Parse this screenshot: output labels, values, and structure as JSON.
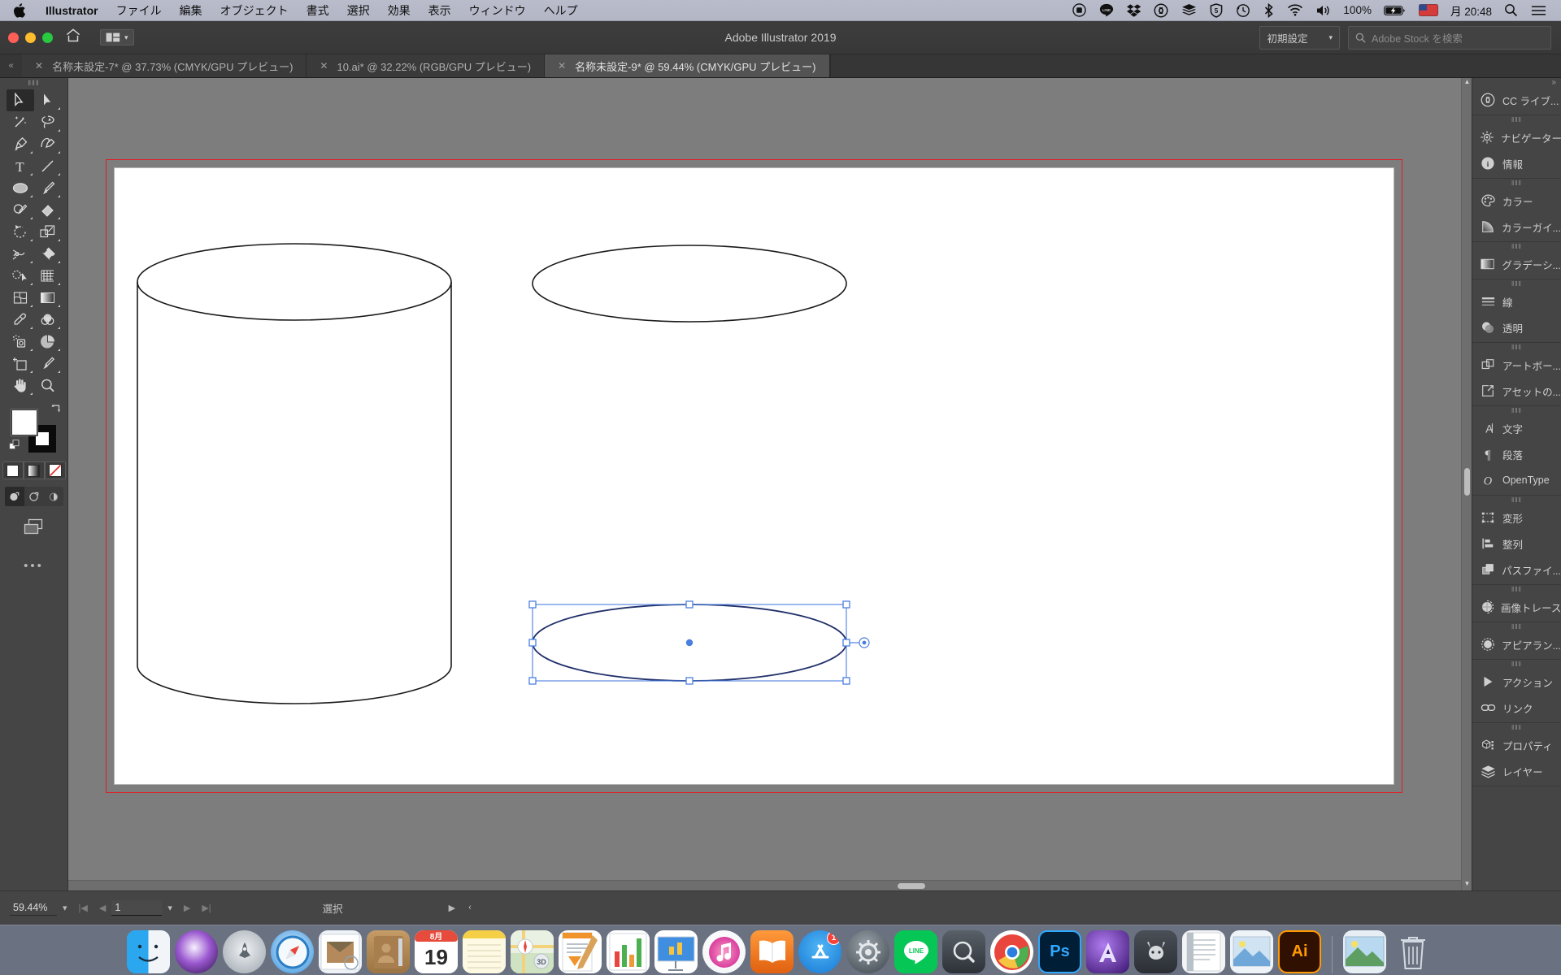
{
  "macbar": {
    "apple": "apple-logo",
    "app": "Illustrator",
    "menus": [
      "ファイル",
      "編集",
      "オブジェクト",
      "書式",
      "選択",
      "効果",
      "表示",
      "ウィンドウ",
      "ヘルプ"
    ],
    "status_icons": [
      "record-icon",
      "line-icon",
      "dropbox-icon",
      "creative-cloud-icon",
      "stack-icon",
      "shield5-icon",
      "time-machine-icon",
      "bluetooth-icon",
      "wifi-icon",
      "volume-icon"
    ],
    "battery_percent": "100%",
    "input_source": "A",
    "clock": "月 20:48",
    "search_icon": "search-icon",
    "menu_icon": "control-center-icon"
  },
  "titlebar": {
    "app_title": "Adobe Illustrator 2019",
    "arrange_icon": "arrange-documents-icon",
    "home_icon": "home-icon",
    "workspace": "初期設定",
    "stock_placeholder": "Adobe Stock を検索",
    "stock_icon": "adobe-stock-icon"
  },
  "tabs": [
    {
      "label": "名称未設定-7* @ 37.73% (CMYK/GPU プレビュー)",
      "active": false
    },
    {
      "label": "10.ai* @ 32.22% (RGB/GPU プレビュー)",
      "active": false
    },
    {
      "label": "名称未設定-9* @ 59.44% (CMYK/GPU プレビュー)",
      "active": true
    }
  ],
  "toolbar": {
    "tools": [
      {
        "name": "selection-tool",
        "glyph": "selection",
        "selected": true
      },
      {
        "name": "direct-selection-tool",
        "glyph": "direct",
        "selected": false
      },
      {
        "name": "magic-wand-tool",
        "glyph": "wand",
        "selected": false
      },
      {
        "name": "lasso-tool",
        "glyph": "lasso",
        "selected": false
      },
      {
        "name": "pen-tool",
        "glyph": "pen",
        "selected": false
      },
      {
        "name": "curvature-tool",
        "glyph": "curvature",
        "selected": false
      },
      {
        "name": "type-tool",
        "glyph": "type",
        "selected": false
      },
      {
        "name": "line-segment-tool",
        "glyph": "line",
        "selected": false
      },
      {
        "name": "ellipse-tool",
        "glyph": "ellipse",
        "selected": false
      },
      {
        "name": "paintbrush-tool",
        "glyph": "brush",
        "selected": false
      },
      {
        "name": "shaper-tool",
        "glyph": "shaper",
        "selected": false
      },
      {
        "name": "eraser-tool",
        "glyph": "eraser",
        "selected": false
      },
      {
        "name": "rotate-tool",
        "glyph": "rotate",
        "selected": false
      },
      {
        "name": "scale-tool",
        "glyph": "scale",
        "selected": false
      },
      {
        "name": "width-tool",
        "glyph": "width",
        "selected": false
      },
      {
        "name": "free-transform-tool",
        "glyph": "pin",
        "selected": false
      },
      {
        "name": "shape-builder-tool",
        "glyph": "shapebuilder",
        "selected": false
      },
      {
        "name": "perspective-grid-tool",
        "glyph": "perspective",
        "selected": false
      },
      {
        "name": "mesh-tool",
        "glyph": "mesh",
        "selected": false
      },
      {
        "name": "gradient-tool",
        "glyph": "gradient",
        "selected": false
      },
      {
        "name": "eyedropper-tool",
        "glyph": "eyedropper",
        "selected": false
      },
      {
        "name": "blend-tool",
        "glyph": "blend",
        "selected": false
      },
      {
        "name": "symbol-sprayer-tool",
        "glyph": "sprayer",
        "selected": false
      },
      {
        "name": "column-graph-tool",
        "glyph": "graph",
        "selected": false
      },
      {
        "name": "artboard-tool",
        "glyph": "artboard",
        "selected": false
      },
      {
        "name": "slice-tool",
        "glyph": "slice",
        "selected": false
      },
      {
        "name": "hand-tool",
        "glyph": "hand",
        "selected": false
      },
      {
        "name": "zoom-tool",
        "glyph": "zoom",
        "selected": false
      }
    ],
    "fill_color": "#ffffff",
    "stroke_color": "#000000",
    "paint_modes": [
      "color-swatch",
      "gradient-swatch",
      "none-swatch"
    ],
    "draw_modes": [
      "draw-normal",
      "draw-behind",
      "draw-inside"
    ],
    "screen_mode_icon": "change-screen-mode-icon",
    "more_tools": "•••"
  },
  "canvas": {
    "zoom": "59.44%",
    "artboard_bg": "#ffffff",
    "bleed_color": "#e11d26",
    "shapes": [
      {
        "name": "cylinder-body",
        "type": "cylinder"
      },
      {
        "name": "ellipse-top-right",
        "type": "ellipse"
      },
      {
        "name": "ellipse-selected",
        "type": "ellipse",
        "selected": true
      }
    ],
    "selection_color": "#4a7fe0"
  },
  "right_dock": {
    "collapse_icon": "double-arrow-right-icon",
    "groups": [
      {
        "items": [
          {
            "label": "CC ライブ...",
            "icon": "creative-cloud-libraries-icon"
          }
        ]
      },
      {
        "items": [
          {
            "label": "ナビゲーター",
            "icon": "navigator-icon"
          },
          {
            "label": "情報",
            "icon": "info-icon"
          }
        ]
      },
      {
        "items": [
          {
            "label": "カラー",
            "icon": "color-icon"
          },
          {
            "label": "カラーガイ...",
            "icon": "color-guide-icon"
          }
        ]
      },
      {
        "items": [
          {
            "label": "グラデーシ...",
            "icon": "gradient-icon"
          }
        ]
      },
      {
        "items": [
          {
            "label": "線",
            "icon": "stroke-icon"
          },
          {
            "label": "透明",
            "icon": "transparency-icon"
          }
        ]
      },
      {
        "items": [
          {
            "label": "アートボー...",
            "icon": "artboards-icon"
          },
          {
            "label": "アセットの...",
            "icon": "asset-export-icon"
          }
        ]
      },
      {
        "items": [
          {
            "label": "文字",
            "icon": "character-icon"
          },
          {
            "label": "段落",
            "icon": "paragraph-icon"
          },
          {
            "label": "OpenType",
            "icon": "opentype-icon"
          }
        ]
      },
      {
        "items": [
          {
            "label": "変形",
            "icon": "transform-icon"
          },
          {
            "label": "整列",
            "icon": "align-icon"
          },
          {
            "label": "パスファイ...",
            "icon": "pathfinder-icon"
          }
        ]
      },
      {
        "items": [
          {
            "label": "画像トレース",
            "icon": "image-trace-icon"
          }
        ]
      },
      {
        "items": [
          {
            "label": "アピアラン...",
            "icon": "appearance-icon"
          }
        ]
      },
      {
        "items": [
          {
            "label": "アクション",
            "icon": "actions-icon"
          },
          {
            "label": "リンク",
            "icon": "links-icon"
          }
        ]
      },
      {
        "items": [
          {
            "label": "プロパティ",
            "icon": "properties-icon"
          },
          {
            "label": "レイヤー",
            "icon": "layers-icon"
          }
        ]
      }
    ]
  },
  "statusbar": {
    "zoom_value": "59.44%",
    "zoom_dropdown_icon": "chevron-down-icon",
    "first_page_icon": "first-page-icon",
    "prev_page_icon": "prev-page-icon",
    "page_value": "1",
    "page_dropdown_icon": "chevron-down-icon",
    "next_page_icon": "next-page-icon",
    "last_page_icon": "last-page-icon",
    "status_text": "選択",
    "status_menu_icon": "play-right-icon",
    "resize_icon": "chevron-left-icon"
  },
  "dock": {
    "items": [
      {
        "name": "finder",
        "label": "",
        "color": "#2aa7ef",
        "running": true
      },
      {
        "name": "siri",
        "label": "",
        "color": "#5a3e8e",
        "running": false
      },
      {
        "name": "launchpad",
        "label": "",
        "color": "#9aa0a6",
        "running": false
      },
      {
        "name": "safari",
        "label": "",
        "color": "#2b8fe0",
        "running": false
      },
      {
        "name": "mail",
        "label": "",
        "color": "#dfe6ee",
        "running": false
      },
      {
        "name": "contacts",
        "label": "",
        "color": "#a07848",
        "running": false
      },
      {
        "name": "calendar",
        "label": "19",
        "color": "#ffffff",
        "running": false
      },
      {
        "name": "notes",
        "label": "",
        "color": "#fdf3c0",
        "running": true
      },
      {
        "name": "maps",
        "label": "",
        "color": "#d8ecd0",
        "running": false
      },
      {
        "name": "pages",
        "label": "",
        "color": "#f3a23a",
        "running": false
      },
      {
        "name": "numbers",
        "label": "",
        "color": "#4caf50",
        "running": true
      },
      {
        "name": "keynote",
        "label": "",
        "color": "#3f8ee0",
        "running": false
      },
      {
        "name": "itunes",
        "label": "",
        "color": "#f06292",
        "running": false
      },
      {
        "name": "ibooks",
        "label": "",
        "color": "#e0681f",
        "running": false
      },
      {
        "name": "app-store",
        "label": "",
        "color": "#2b8fe0",
        "running": true,
        "badge": "1"
      },
      {
        "name": "system-preferences",
        "label": "",
        "color": "#6b7280",
        "running": false
      },
      {
        "name": "line",
        "label": "LINE",
        "color": "#06c755",
        "running": true
      },
      {
        "name": "quicklook",
        "label": "Q",
        "color": "#3a3f46",
        "running": false
      },
      {
        "name": "chrome",
        "label": "",
        "color": "#f4f4f4",
        "running": true
      },
      {
        "name": "photoshop",
        "label": "Ps",
        "color": "#001e36",
        "running": true
      },
      {
        "name": "after-effects",
        "label": "",
        "color": "#1f0a3c",
        "running": true
      },
      {
        "name": "deer-app",
        "label": "",
        "color": "#3c3f46",
        "running": false
      },
      {
        "name": "text-editor",
        "label": "",
        "color": "#f2f2f2",
        "running": false
      },
      {
        "name": "preview",
        "label": "",
        "color": "#dfe7f0",
        "running": false
      },
      {
        "name": "illustrator",
        "label": "Ai",
        "color": "#301000",
        "running": true
      },
      {
        "name": "pictures-folder",
        "label": "",
        "color": "#6fa8d8",
        "running": false
      },
      {
        "name": "trash",
        "label": "",
        "color": "#c9ced6",
        "running": false
      }
    ]
  }
}
